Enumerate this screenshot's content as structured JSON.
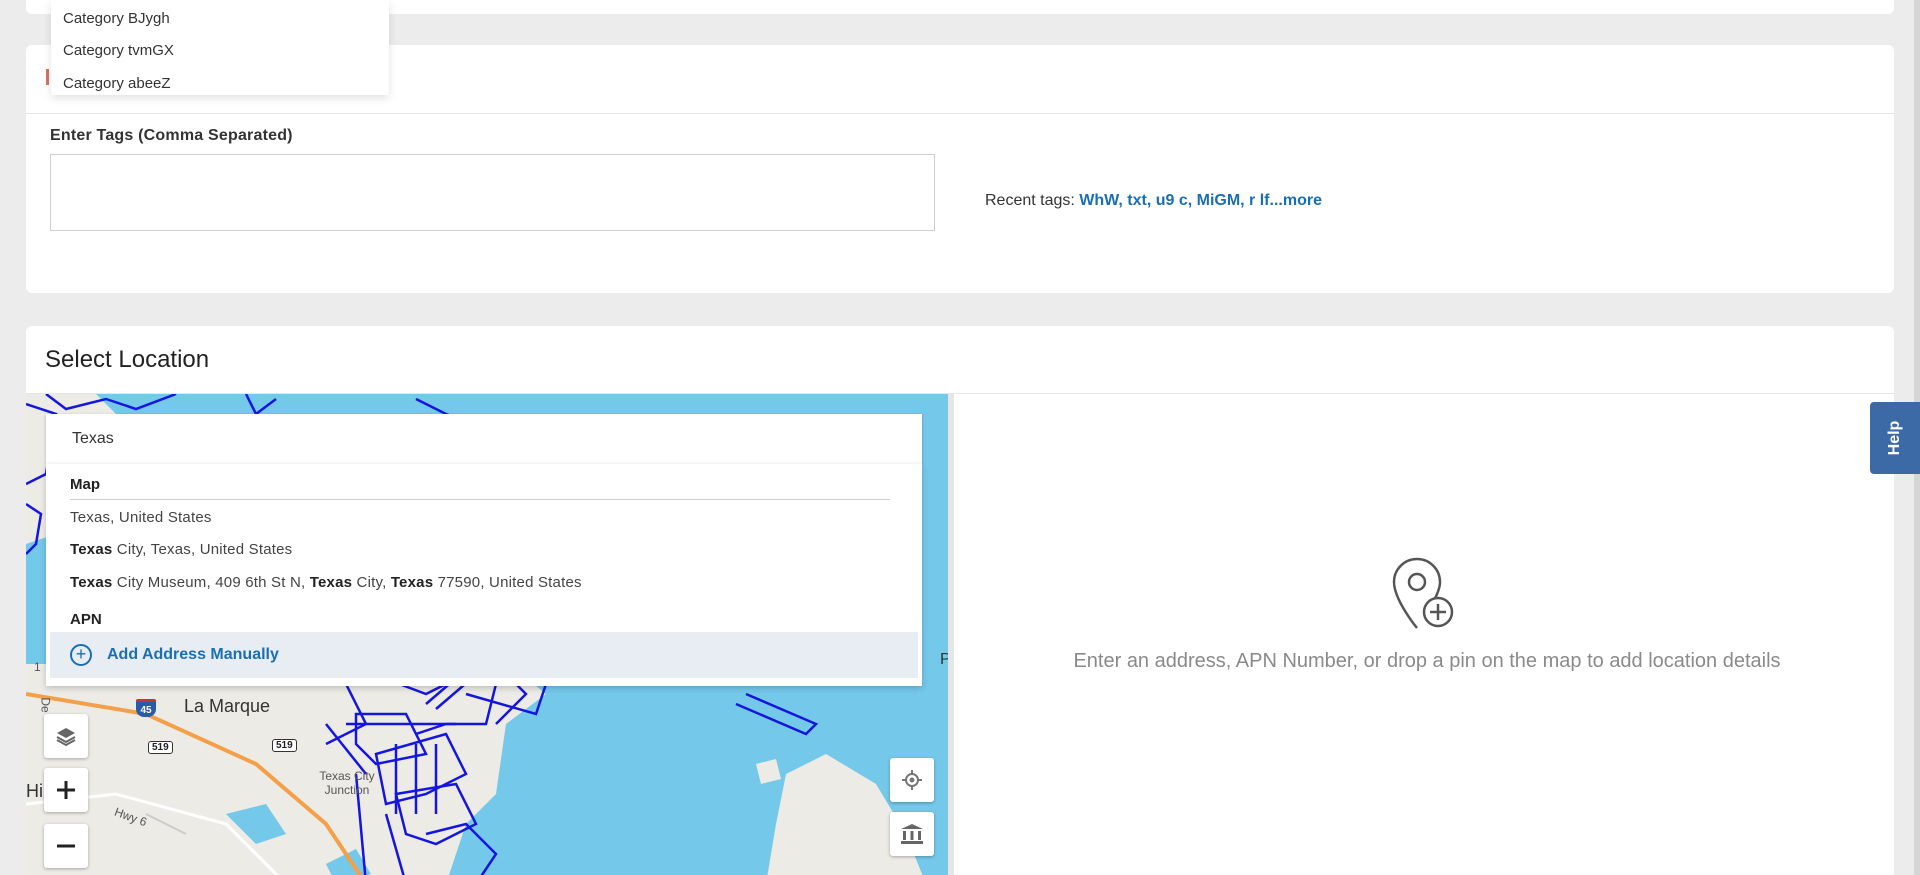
{
  "category_dropdown": {
    "options": [
      "Category BJygh",
      "Category tvmGX",
      "Category abeeZ"
    ]
  },
  "tags": {
    "label": "Enter Tags (Comma Separated)",
    "value": "",
    "recent_label": "Recent tags:",
    "recent_values": "WhW, txt, u9 c, MiGM, r lf...more"
  },
  "location": {
    "title": "Select Location",
    "search_value": "Texas",
    "sections": {
      "map_header": "Map",
      "apn_header": "APN"
    },
    "suggestions": [
      {
        "parts": [
          {
            "text": "Texas, United States",
            "bold": false
          }
        ]
      },
      {
        "parts": [
          {
            "text": "Texas",
            "bold": true
          },
          {
            "text": " City, Texas, United States",
            "bold": false
          }
        ]
      },
      {
        "parts": [
          {
            "text": "Texas",
            "bold": true
          },
          {
            "text": " City Museum, 409 6th St N, ",
            "bold": false
          },
          {
            "text": "Texas",
            "bold": true
          },
          {
            "text": " City, ",
            "bold": false
          },
          {
            "text": "Texas",
            "bold": true
          },
          {
            "text": " 77590, United States",
            "bold": false
          }
        ]
      }
    ],
    "add_manual_label": "Add Address Manually",
    "empty_state": "Enter an address, APN Number, or drop a pin on the map to add location details"
  },
  "map": {
    "labels": {
      "la_marque": "La Marque",
      "hitchcock": "Hi   ck",
      "texas_city_junction": "Texas City Junction",
      "hwy6": "Hwy 6",
      "partial_p": "Po",
      "partial_1": "1",
      "partial_de": "De"
    },
    "shields": {
      "i45": "45",
      "r519a": "519",
      "r519b": "519"
    },
    "colors": {
      "water": "#74c8ea",
      "land": "#ecebe5",
      "parcels": "#1515e0",
      "highway": "#f4a04a"
    }
  },
  "help": {
    "label": "Help"
  }
}
